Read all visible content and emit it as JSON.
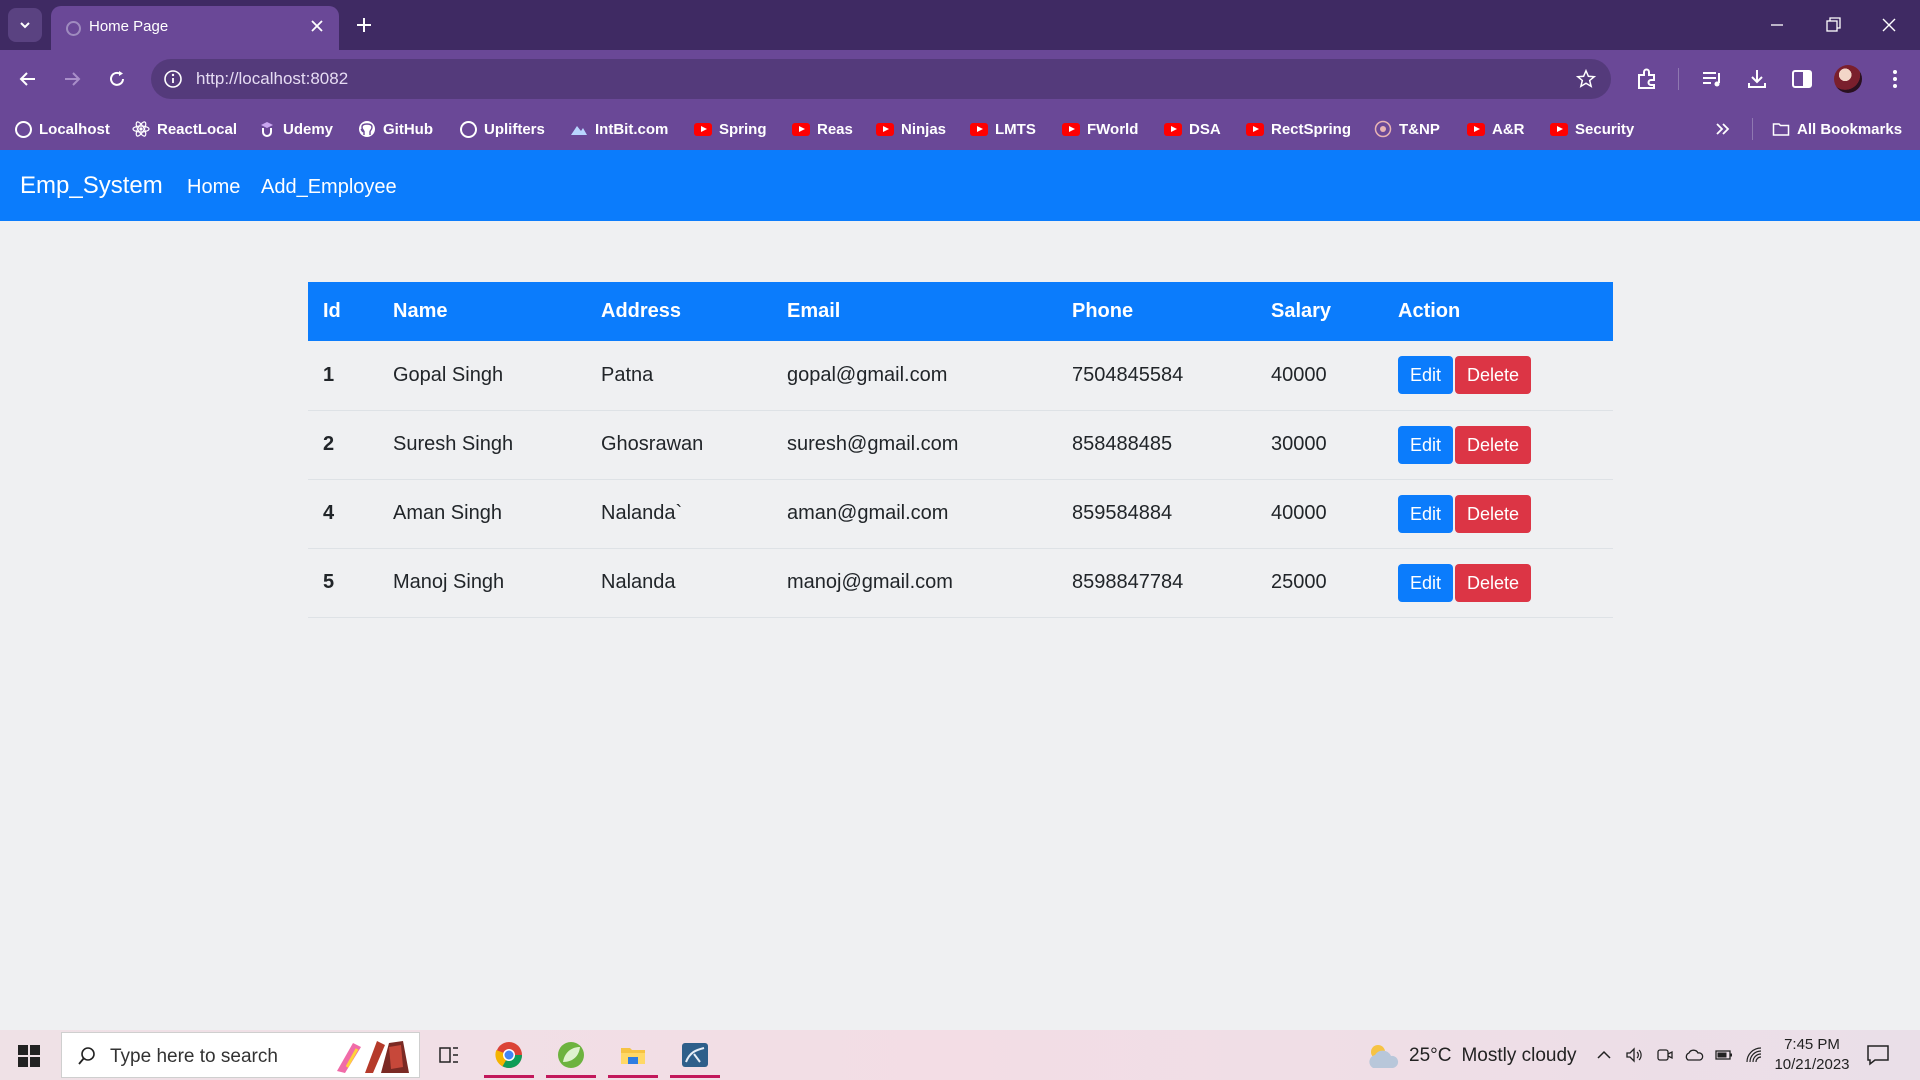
{
  "browser": {
    "tab_title": "Home Page",
    "url": "http://localhost:8082",
    "bookmarks": [
      {
        "label": "Localhost",
        "icon": "globe-icon"
      },
      {
        "label": "ReactLocal",
        "icon": "react-icon"
      },
      {
        "label": "Udemy",
        "icon": "udemy-icon"
      },
      {
        "label": "GitHub",
        "icon": "github-icon"
      },
      {
        "label": "Uplifters",
        "icon": "globe-icon"
      },
      {
        "label": "IntBit.com",
        "icon": "intbit-icon"
      },
      {
        "label": "Spring",
        "icon": "youtube-icon"
      },
      {
        "label": "Reas",
        "icon": "youtube-icon"
      },
      {
        "label": "Ninjas",
        "icon": "youtube-icon"
      },
      {
        "label": "LMTS",
        "icon": "youtube-icon"
      },
      {
        "label": "FWorld",
        "icon": "youtube-icon"
      },
      {
        "label": "DSA",
        "icon": "youtube-icon"
      },
      {
        "label": "RectSpring",
        "icon": "youtube-icon"
      },
      {
        "label": "T&NP",
        "icon": "tnp-icon"
      },
      {
        "label": "A&R",
        "icon": "youtube-icon"
      },
      {
        "label": "Security",
        "icon": "youtube-icon"
      }
    ],
    "all_bookmarks_label": "All Bookmarks"
  },
  "app": {
    "brand": "Emp_System",
    "nav": {
      "home": "Home",
      "add": "Add_Employee"
    },
    "colors": {
      "primary": "#0b7cfc",
      "danger": "#dc3545"
    }
  },
  "table": {
    "headers": {
      "id": "Id",
      "name": "Name",
      "address": "Address",
      "email": "Email",
      "phone": "Phone",
      "salary": "Salary",
      "action": "Action"
    },
    "rows": [
      {
        "id": "1",
        "name": "Gopal Singh",
        "address": "Patna",
        "email": "gopal@gmail.com",
        "phone": "7504845584",
        "salary": "40000"
      },
      {
        "id": "2",
        "name": "Suresh Singh",
        "address": "Ghosrawan",
        "email": "suresh@gmail.com",
        "phone": "858488485",
        "salary": "30000"
      },
      {
        "id": "4",
        "name": "Aman Singh",
        "address": "Nalanda`",
        "email": "aman@gmail.com",
        "phone": "859584884",
        "salary": "40000"
      },
      {
        "id": "5",
        "name": "Manoj Singh",
        "address": "Nalanda",
        "email": "manoj@gmail.com",
        "phone": "8598847784",
        "salary": "25000"
      }
    ],
    "edit_label": "Edit",
    "delete_label": "Delete"
  },
  "taskbar": {
    "search_placeholder": "Type here to search",
    "weather_temp": "25°C",
    "weather_text": "Mostly cloudy",
    "time": "7:45 PM",
    "date": "10/21/2023"
  }
}
